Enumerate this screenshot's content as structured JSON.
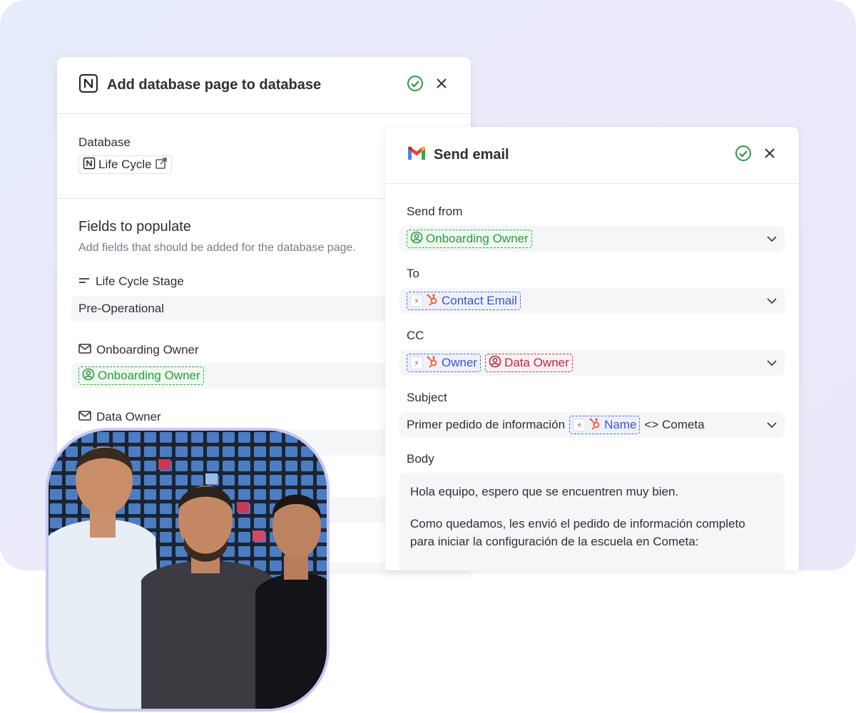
{
  "notion_card": {
    "title": "Add database page to database",
    "database_label": "Database",
    "database_value": "Life Cycle",
    "fields_heading": "Fields to populate",
    "fields_subtext": "Add fields that should be added for the database page.",
    "fields": [
      {
        "label": "Life Cycle Stage",
        "value": "Pre-Operational"
      },
      {
        "label": "Onboarding Owner",
        "value": "Onboarding Owner"
      },
      {
        "label": "Data Owner"
      }
    ]
  },
  "gmail_card": {
    "title": "Send email",
    "send_from_label": "Send from",
    "send_from_value": "Onboarding Owner",
    "to_label": "To",
    "to_value": "Contact Email",
    "cc_label": "CC",
    "cc_values": [
      "Owner",
      "Data Owner"
    ],
    "subject_label": "Subject",
    "subject_prefix": "Primer pedido de información",
    "subject_token": "Name",
    "subject_suffix": "<> Cometa",
    "body_label": "Body",
    "body_line1": "Hola equipo, espero que se encuentren muy bien.",
    "body_line2": "Como quedamos, les envió el pedido de información completo",
    "body_line3": "para iniciar la configuración de la escuela en Cometa:"
  },
  "colors": {
    "success_green": "#2a9a43",
    "token_blue": "#3c57c7",
    "token_red": "#b52c43",
    "hubspot_orange": "#f0623a",
    "photo_border": "#c7c9f3"
  }
}
